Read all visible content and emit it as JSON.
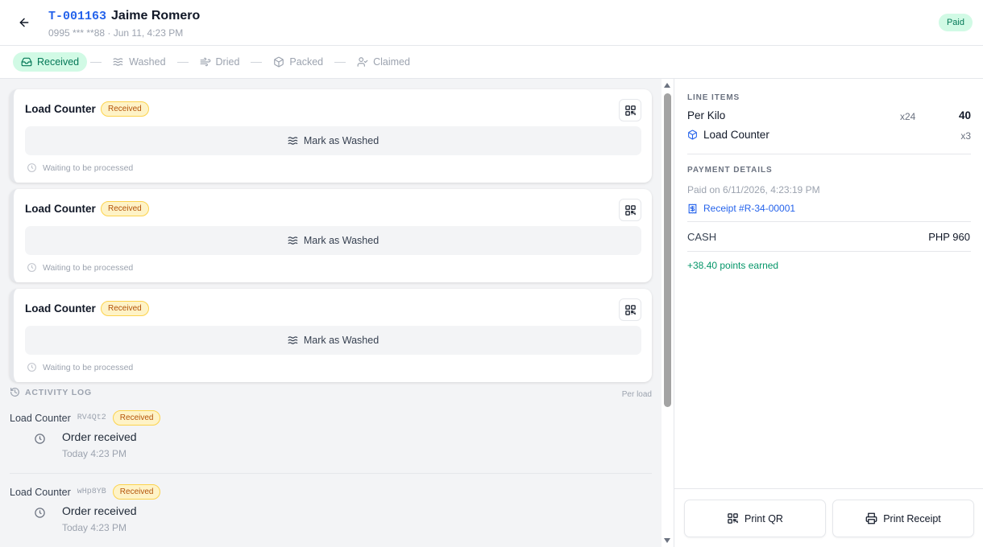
{
  "header": {
    "ticket_id": "T-001163",
    "customer_name": "Jaime Romero",
    "subtitle": "0995 *** **88 · Jun 11, 4:23 PM",
    "status_badge": "Paid",
    "back_icon": "arrow-left-icon"
  },
  "stages": [
    {
      "label": "Received",
      "icon": "inbox-icon",
      "active": true
    },
    {
      "label": "Washed",
      "icon": "waves-icon",
      "active": false
    },
    {
      "label": "Dried",
      "icon": "wind-icon",
      "active": false
    },
    {
      "label": "Packed",
      "icon": "package-icon",
      "active": false
    },
    {
      "label": "Claimed",
      "icon": "user-check-icon",
      "active": false
    }
  ],
  "loads": [
    {
      "title": "Load Counter",
      "badge": "Received",
      "action": "Mark as Washed",
      "status": "Waiting to be processed"
    },
    {
      "title": "Load Counter",
      "badge": "Received",
      "action": "Mark as Washed",
      "status": "Waiting to be processed"
    },
    {
      "title": "Load Counter",
      "badge": "Received",
      "action": "Mark as Washed",
      "status": "Waiting to be processed"
    }
  ],
  "activity_log": {
    "title": "ACTIVITY LOG",
    "mode": "Per load",
    "entries": [
      {
        "name": "Load Counter",
        "code": "RV4Qt2",
        "badge": "Received",
        "event": "Order received",
        "time": "Today 4:23 PM"
      },
      {
        "name": "Load Counter",
        "code": "wHp8YB",
        "badge": "Received",
        "event": "Order received",
        "time": "Today 4:23 PM"
      }
    ]
  },
  "line_items": {
    "title": "LINE ITEMS",
    "items": [
      {
        "name": "Per Kilo",
        "qty": "x24",
        "amount": "40"
      },
      {
        "name": "Load Counter",
        "qty": "x3",
        "amount": ""
      }
    ]
  },
  "payment": {
    "title": "PAYMENT DETAILS",
    "paid_on": "Paid on 6/11/2026, 4:23:19 PM",
    "receipt": "Receipt #R-34-00001",
    "method": "CASH",
    "amount": "PHP 960",
    "points": "+38.40 points earned"
  },
  "actions": {
    "print_qr": "Print QR",
    "print_receipt": "Print Receipt"
  },
  "colors": {
    "accent": "#2563eb",
    "success": "#047857",
    "success_bg": "#d1fae5",
    "warning": "#b45309",
    "warning_bg": "#fef3c7"
  }
}
